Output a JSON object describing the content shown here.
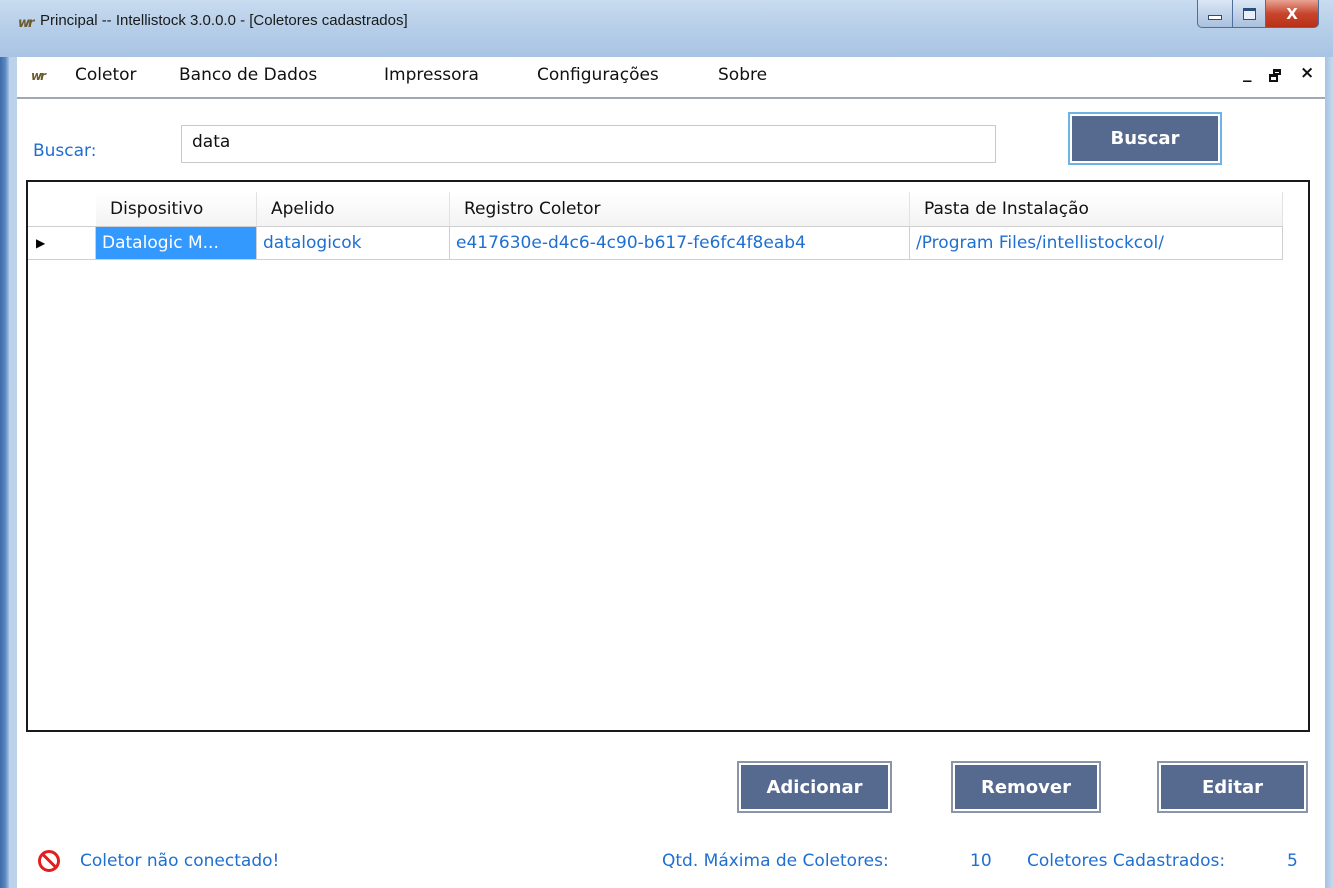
{
  "window": {
    "title": "Principal -- Intellistock 3.0.0.0 - [Coletores cadastrados]",
    "icon": "intellistock-logo-icon",
    "minimize_glyph": "▁",
    "maximize_glyph": "□",
    "close_glyph": "X"
  },
  "menubar": {
    "items": [
      "Coletor",
      "Banco de Dados",
      "Impressora",
      "Configurações",
      "Sobre"
    ],
    "mdi_minimize": "_",
    "mdi_restore": "ฃ",
    "mdi_close": "×"
  },
  "search": {
    "label": "Buscar:",
    "value": "data",
    "button_label": "Buscar"
  },
  "grid": {
    "columns": [
      "Dispositivo",
      "Apelido",
      "Registro Coletor",
      "Pasta de Instalação"
    ],
    "rows": [
      {
        "indicator": "▶",
        "cells": [
          "Datalogic M...",
          "datalogicok",
          "e417630e-d4c6-4c90-b617-fe6fc4f8eab4",
          "/Program Files/intellistockcol/"
        ]
      }
    ]
  },
  "actions": {
    "add_label": "Adicionar",
    "remove_label": "Remover",
    "edit_label": "Editar"
  },
  "status": {
    "icon": "no-entry-icon",
    "connection": "Coletor não conectado!",
    "max_label": "Qtd. Máxima de Coletores:",
    "max_value": "10",
    "registered_label": "Coletores Cadastrados:",
    "registered_value": "5"
  },
  "colors": {
    "accent_text": "#1f6fd1",
    "button_bg": "#556a8e",
    "selection": "#3399ff",
    "error": "#e02020"
  }
}
